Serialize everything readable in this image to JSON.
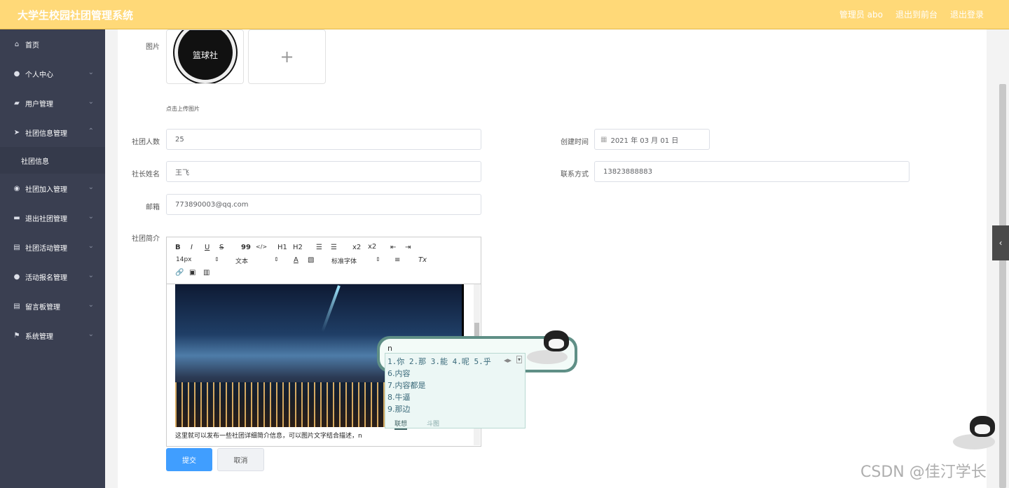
{
  "header": {
    "app_title": "大学生校园社团管理系统",
    "user": "管理员 abo",
    "to_frontend": "退出到前台",
    "logout": "退出登录"
  },
  "sidebar": {
    "items": [
      {
        "label": "首页",
        "icon": "home-icon"
      },
      {
        "label": "个人中心",
        "icon": "user-icon"
      },
      {
        "label": "用户管理",
        "icon": "users-icon"
      },
      {
        "label": "社团信息管理",
        "icon": "send-icon"
      },
      {
        "label": "社团加入管理",
        "icon": "location-icon"
      },
      {
        "label": "退出社团管理",
        "icon": "chat-icon"
      },
      {
        "label": "社团活动管理",
        "icon": "clipboard-icon"
      },
      {
        "label": "活动报名管理",
        "icon": "user-icon"
      },
      {
        "label": "留言板管理",
        "icon": "clipboard-icon"
      },
      {
        "label": "系统管理",
        "icon": "flag-icon"
      }
    ],
    "sub_item": "社团信息"
  },
  "form": {
    "image_label": "图片",
    "logo_text": "篮球社",
    "upload_hint": "点击上传图片",
    "members_label": "社团人数",
    "members_value": "25",
    "created_label": "创建时间",
    "created_value": "2021 年 03 月 01 日",
    "leader_label": "社长姓名",
    "leader_value": "王飞",
    "contact_label": "联系方式",
    "contact_value": "13823888883",
    "email_label": "邮箱",
    "email_value": "773890003@qq.com",
    "intro_label": "社团简介",
    "editor_text": "这里就可以发布一些社团详细简介信息，可以图片文字结合描述，n",
    "submit": "提交",
    "cancel": "取消"
  },
  "toolbar": {
    "bold": "B",
    "italic": "I",
    "underline": "U",
    "strike": "S",
    "quote": "99",
    "code": "</>",
    "h1": "H1",
    "h2": "H2",
    "sub": "x2",
    "sup": "x2",
    "font_size": "14px",
    "text_type": "文本",
    "font_family": "标准字体",
    "clear": "Tx"
  },
  "ime": {
    "input": "n",
    "row1": "1.你 2.那 3.能 4.呢 5.乎",
    "candidates": [
      "6.内容",
      "7.内容都是",
      "8.牛逼",
      "9.那边"
    ],
    "tab_lianxiang": "联想",
    "tab_doutu": "斗图"
  },
  "watermark": "CSDN @佳汀学长"
}
